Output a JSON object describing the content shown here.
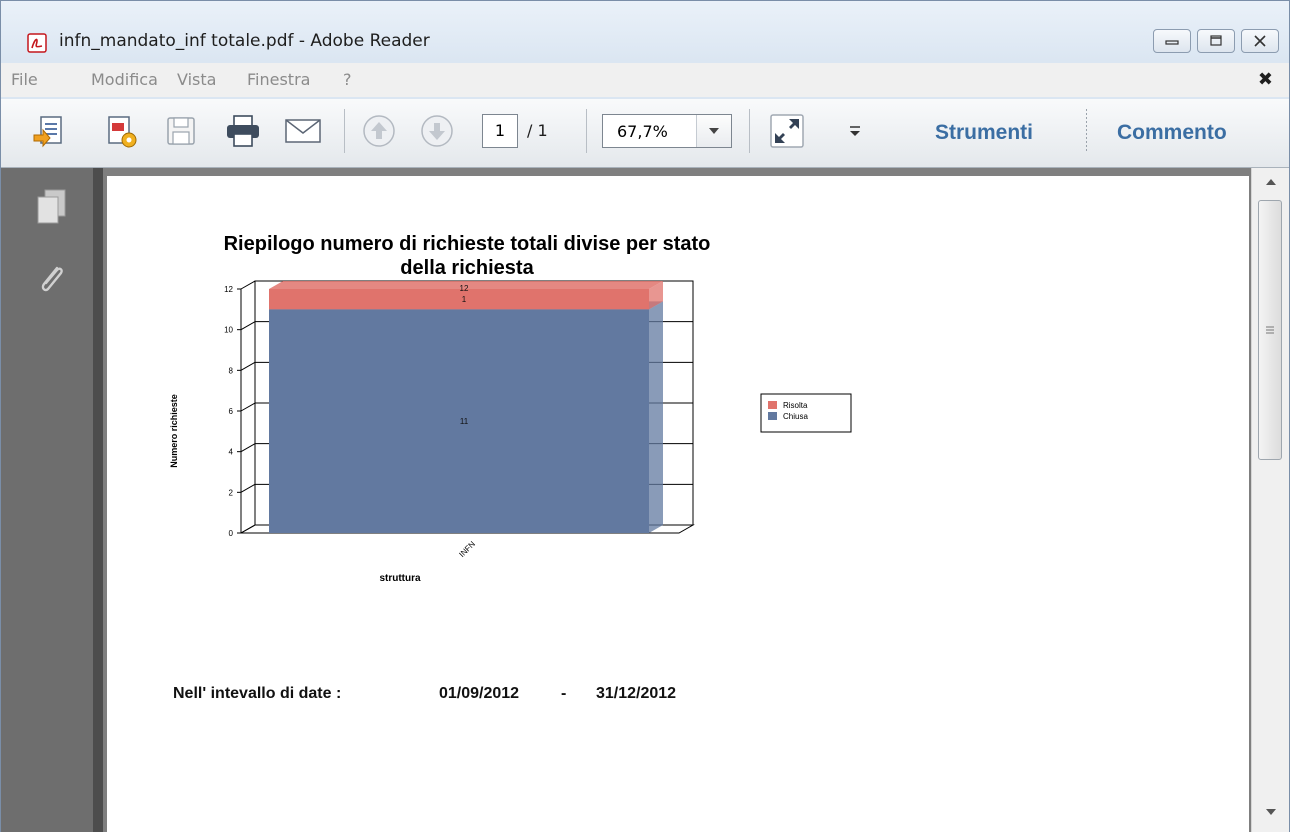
{
  "window": {
    "title": "infn_mandato_inf totale.pdf - Adobe Reader",
    "controls": [
      "minimize",
      "maximize",
      "close"
    ]
  },
  "menu": {
    "items": [
      "File",
      "Modifica",
      "Vista",
      "Finestra",
      "?"
    ],
    "close_glyph": "✖"
  },
  "toolbar": {
    "icons": [
      "create-pdf-icon",
      "export-pdf-icon",
      "save-icon",
      "print-icon",
      "email-icon",
      "previous-page-icon",
      "next-page-icon",
      "fit-page-icon",
      "more-tools-icon"
    ],
    "page_current": "1",
    "page_total": "/ 1",
    "zoom": "67,7%",
    "tools_label": "Strumenti",
    "comment_label": "Commento"
  },
  "document": {
    "chart_title_line1": "Riepilogo numero di richieste totali divise per stato",
    "chart_title_line2": "della richiesta",
    "date_label": "Nell' intevallo di date :",
    "date_from": "01/09/2012",
    "date_sep": "-",
    "date_to": "31/12/2012"
  },
  "chart_data": {
    "type": "bar",
    "stacked": true,
    "categories": [
      "INFN"
    ],
    "series": [
      {
        "name": "Chiusa",
        "values": [
          11
        ],
        "color": "#6279a0"
      },
      {
        "name": "Risolta",
        "values": [
          1
        ],
        "color": "#e0736c"
      }
    ],
    "total_labels": [
      "12"
    ],
    "xlabel": "struttura",
    "ylabel": "Numero richieste",
    "ylim": [
      0,
      12
    ],
    "yticks": [
      0,
      2,
      4,
      6,
      8,
      10,
      12
    ],
    "legend_position": "right",
    "grid": true
  }
}
